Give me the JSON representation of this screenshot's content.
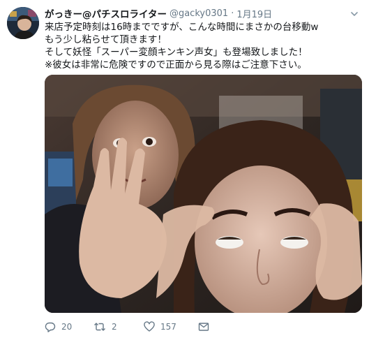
{
  "tweet": {
    "display_name": "がっきー@パチスロライター",
    "handle": "@gacky0301",
    "separator": "·",
    "date": "1月19日",
    "text_lines": [
      "来店予定時刻は16時までですが、こんな時間にまさかの台移動w",
      "もう少し粘らせて頂きます！",
      "そして妖怪「スーパー変顔キンキン声女」も登場致しました！",
      "※彼女は非常に危険ですので正面から見る際はご注意下さい。"
    ]
  },
  "actions": {
    "reply_count": "20",
    "retweet_count": "2",
    "like_count": "157"
  },
  "icons": {
    "reply": "reply-icon",
    "retweet": "retweet-icon",
    "like": "heart-icon",
    "message": "envelope-icon",
    "caret": "chevron-down-icon"
  },
  "colors": {
    "text": "#14171a",
    "secondary": "#657786",
    "background": "#ffffff"
  }
}
